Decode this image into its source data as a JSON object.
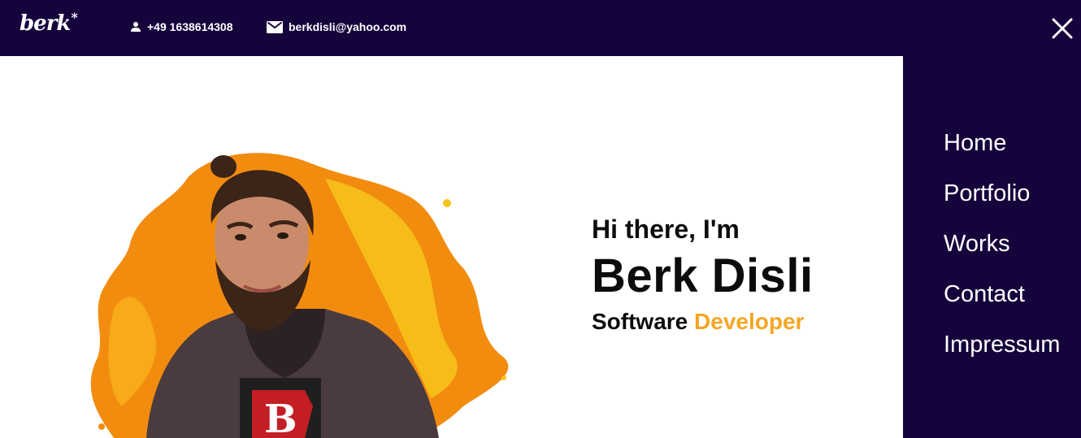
{
  "header": {
    "logo_text": "berk",
    "logo_mark": "*",
    "phone": "+49 1638614308",
    "phone_icon": "person-icon",
    "email": "berkdisli@yahoo.com",
    "email_icon": "mail-icon",
    "close_icon": "close-icon"
  },
  "menu": {
    "items": [
      {
        "label": "Home"
      },
      {
        "label": "Portfolio"
      },
      {
        "label": "Works"
      },
      {
        "label": "Contact"
      },
      {
        "label": "Impressum"
      }
    ]
  },
  "hero": {
    "greeting": "Hi there, I'm",
    "name": "Berk Disli",
    "role_prefix": "Software",
    "role_accent": "Developer"
  },
  "colors": {
    "navy": "#16033c",
    "accent": "#f5a623",
    "splash_orange": "#f28c0f",
    "splash_yellow": "#f7c51a"
  }
}
